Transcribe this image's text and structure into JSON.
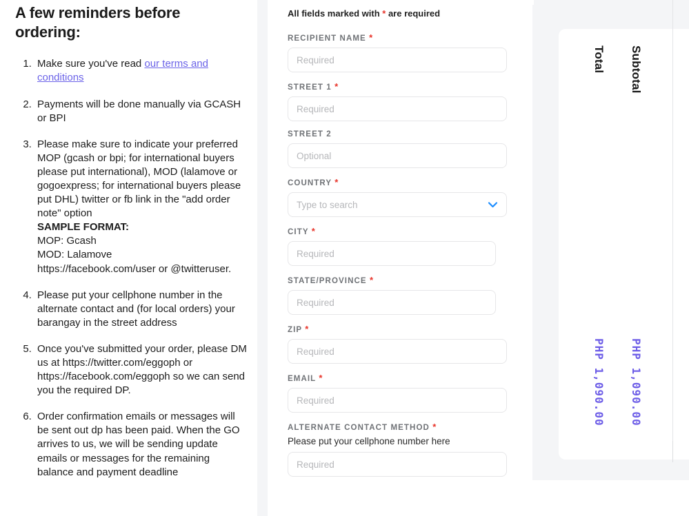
{
  "reminders": {
    "title": "A few reminders before ordering:",
    "items": [
      {
        "id": 1,
        "prefix": "Make sure you've read ",
        "link": "our terms and conditions",
        "style": "normal"
      },
      {
        "id": 2,
        "text": "Payments will be done manually via GCASH or BPI",
        "style": "italic"
      },
      {
        "id": 3,
        "text": "Please make sure to indicate your preferred MOP (gcash or bpi; for international buyers please put international), MOD (lalamove or gogoexpress; for international buyers please put DHL) twitter or fb link in the \"add order note\" option",
        "style": "bold",
        "sample_label": "SAMPLE FORMAT:",
        "sample_lines": [
          "MOP: Gcash",
          "MOD: Lalamove",
          "https://facebook.com/user or @twitteruser."
        ]
      },
      {
        "id": 4,
        "text": "Please put your cellphone number in the alternate contact and (for local orders) your barangay in the street address",
        "style": "bold"
      },
      {
        "id": 5,
        "text": "Once you've submitted your order, please DM us at https://twitter.com/eggoph or https://facebook.com/eggoph so we can send you the required DP.",
        "style": "bold"
      },
      {
        "id": 6,
        "text": "Order confirmation emails or messages will be sent out dp has been paid. When the GO arrives to us, we will be sending update emails or messages for the remaining balance and payment deadline",
        "style": "normal"
      }
    ]
  },
  "form": {
    "required_note_prefix": "All fields marked with ",
    "required_note_star": "*",
    "required_note_suffix": " are required",
    "fields": [
      {
        "label": "RECIPIENT NAME",
        "required": true,
        "placeholder": "Required",
        "type": "text",
        "width": "wide"
      },
      {
        "label": "STREET 1",
        "required": true,
        "placeholder": "Required",
        "type": "text",
        "width": "wide"
      },
      {
        "label": "STREET 2",
        "required": false,
        "placeholder": "Optional",
        "type": "text",
        "width": "wide"
      },
      {
        "label": "COUNTRY",
        "required": true,
        "placeholder": "Type to search",
        "type": "select",
        "width": "wide"
      },
      {
        "label": "CITY",
        "required": true,
        "placeholder": "Required",
        "type": "text",
        "width": "narrow"
      },
      {
        "label": "STATE/PROVINCE",
        "required": true,
        "placeholder": "Required",
        "type": "text",
        "width": "narrow"
      },
      {
        "label": "ZIP",
        "required": true,
        "placeholder": "Required",
        "type": "text",
        "width": "narrow"
      },
      {
        "label": "EMAIL",
        "required": true,
        "placeholder": "Required",
        "type": "text",
        "width": "wide"
      },
      {
        "label": "ALTERNATE CONTACT METHOD",
        "required": true,
        "placeholder": "Required",
        "type": "text",
        "width": "wide",
        "help": "Please put your cellphone number here"
      }
    ]
  },
  "summary": {
    "rows": [
      {
        "label": "Subtotal",
        "value": "PHP 1,090.00"
      },
      {
        "label": "Total",
        "value": "PHP 1,090.00"
      }
    ]
  },
  "colors": {
    "link": "#6B63E8",
    "currency": "#6C5CE7",
    "required_star": "#e8342a",
    "chevron": "#1A8CFF",
    "panel_bg": "#f4f5f7"
  }
}
